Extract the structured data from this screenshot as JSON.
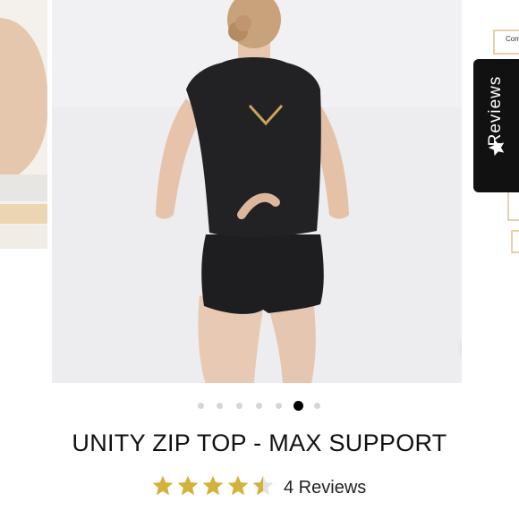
{
  "product": {
    "title": "UNITY ZIP TOP - MAX SUPPORT",
    "rating": 4.5,
    "rating_max": 5,
    "review_count_label": "4 Reviews"
  },
  "reviews_tab": {
    "label": "Reviews",
    "icon": "star-icon"
  },
  "carousel": {
    "slide_count": 7,
    "active_index": 5,
    "next_slide_text": "Com",
    "zoom_icon": "magnifier-icon"
  },
  "colors": {
    "star": "#d4b13a",
    "star_empty": "#e3e3e3",
    "reviews_tab_bg": "#111111",
    "dot_active": "#000000",
    "dot_inactive": "#d6d6d6",
    "gold_trim": "#c9a45a"
  }
}
